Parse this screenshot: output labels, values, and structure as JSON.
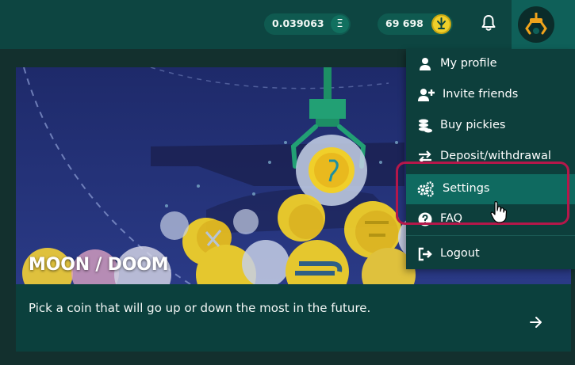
{
  "header": {
    "eth_balance": "0.039063",
    "eth_icon": "Ξ",
    "pickies_balance": "69 698",
    "pickies_icon": "pickie-coin-icon",
    "notifications_icon": "bell-icon",
    "avatar_icon": "claw-avatar-icon"
  },
  "game_card": {
    "title": "MOON / DOOM",
    "description": "Pick a coin that will go up or down the most in the future."
  },
  "menu": {
    "items": [
      {
        "label": "My profile",
        "icon": "user-icon"
      },
      {
        "label": "Invite friends",
        "icon": "user-plus-icon"
      },
      {
        "label": "Buy pickies",
        "icon": "coins-icon"
      },
      {
        "label": "Deposit/withdrawal",
        "icon": "exchange-icon"
      },
      {
        "label": "Settings",
        "icon": "gears-icon"
      },
      {
        "label": "FAQ",
        "icon": "question-icon"
      },
      {
        "label": "Logout",
        "icon": "sign-out-icon"
      }
    ],
    "active_item": "Settings"
  },
  "colors": {
    "header_bg": "#0d4541",
    "menu_bg": "#0d3f3c",
    "menu_active": "#0f6a60",
    "highlight": "#b5174a",
    "coin_yellow": "#f0cf2a"
  }
}
